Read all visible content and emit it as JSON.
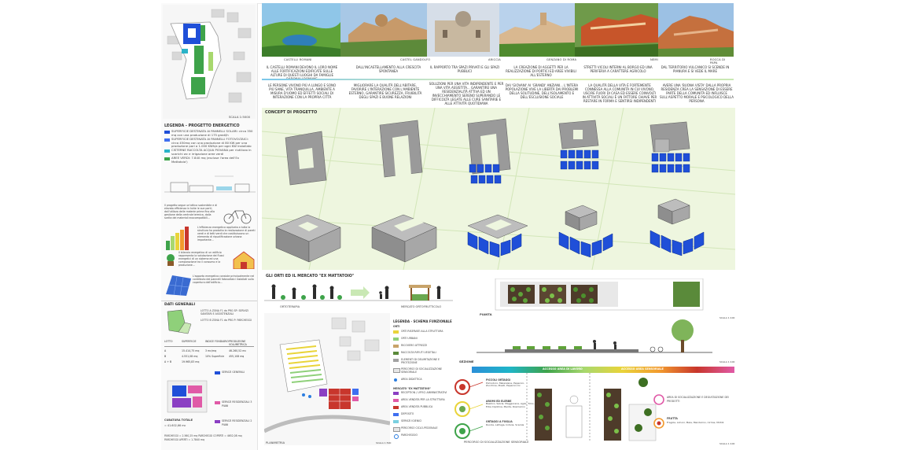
{
  "colors": {
    "blue": "#1f4fd8",
    "blue_light": "#3f6ff0",
    "gray_block": "#8c8c8c",
    "green": "#3ea34a",
    "green_light": "#a8d86e",
    "concept_bg": "#eef6df",
    "pink": "#e05aa7",
    "purple": "#8b3fc3",
    "red": "#c8362c",
    "yellow": "#e9d43a"
  },
  "photos": [
    {
      "caption": "CASTELLI ROMANI",
      "desc": "Il castelli romani devono il loro nome alle fortificazioni edificate sulle alture di questi luoghi da famiglie baronali romane"
    },
    {
      "caption": "CASTEL GANDOLFO",
      "desc": "Dall'incastellamento alla crescita spontanea"
    },
    {
      "caption": "ARICCIA",
      "desc": "Il rapporto tra spazi privati e gli spazi pubblici"
    },
    {
      "caption": "GENZANO DI ROMA",
      "desc": "La creazione di aggetti per la realizzazione di portici ed aree vivibili all'esterno"
    },
    {
      "caption": "NEMI",
      "desc": "Stretti vicoli interni al borgo ed una periferia a carattere agricolo"
    },
    {
      "caption": "ROCCA DI PAPA",
      "desc": "Dal territorio vulcanico si scende in pianura e si vede il mare"
    }
  ],
  "principles": [
    "Le persone vivono più a lungo e sono più sane, vita tranquilla, ambiente a misura d'uomo ed effetti sociali di interazione con la propria città",
    "Migliorare la qualità dell'abitare, favorire l'interazione con l'ambiente esterno, garantire sicurezza, fruibilità degli spazi e buone relazioni",
    "Soluzioni per una vita indipendente e per una vita assistita... garantire una residenzialità attiva ed un invecchiamento sereno superando le difficoltà legate alle cure sanitarie e alle attività quotidiana",
    "Dai 'giovani' ai 'grandi' anziani... l'intera popolazione vive la libertà dai problemi della solitudine, dell'isolamento e dell'esclusione sociale",
    "La qualità della vita è fortemente connessa alla comunità in cui vivono, uscire fuori di casa ed essere coinvolti in attività sociali è un fattore chiave per restare in forma e sentirsi indipendenti",
    "Avere una 'buona vista' dalla propria residenza crea la sensazione di essere parte della comunità ed influisce sull'aspetto morale e psicologico della persona"
  ],
  "concept_title": "CONCEPT DI PROGETTO",
  "left_col": {
    "scale": "SCALA 1:5000",
    "legend_title": "LEGENDA - PROGETTO ENERGETICO",
    "legend": [
      "SUPERFICIE DESTINATA AI PANNELLI SOLARI: circa 350 mq con una produzione di 175 gradi/h",
      "SUPERFICIE DESTINATA AI PANNELLI FOTOVOLTAICI: circa 450mq con una produzione di 80 KW per una produzione pari a 1.000 KWh/a per ogni KW installato",
      "CISTERNE RACCOLTA ACQUA PIOVANA per riutilizzo in scarichi wc e irrigazione aree verdi",
      "AREE VERDI: 7.840 mq (escluse l'area dell'Ex Mattatoio')"
    ],
    "energy_text_1": "Il progetto segue un'ottica sostenibile e di elevata efficienza in tutte le sue parti; dall'utilizzo delle materie prime fino alla gestione della centrale termica, dalla scelta dei materiali ecocompatibili...",
    "energy_text_2": "L'efficienza energetica applicata a tutta la struttura ha prodotto la realizzazione di pareti verdi e di tetti verdi che costituiscono un elemento di riqualificazione urbana importante...",
    "energy_text_3": "Il bilancio energetico di un edificio rappresenta la valutazione dei flussi energetici di un sistema ed una comparazione tra il consumo e la produzione...",
    "energy_text_4": "L'apporto energetico consiste principalmente nel contributo dei pannelli fotovoltaici installati sulla copertura dell'edificio...",
    "dati_title": "DATI GENERALI",
    "lotto_labels": [
      "LOTTO A ZONA F1 da PRG SP: SERVIZI SANITARI E ASSISTENZIALI",
      "LOTTO B ZONA F1 da PRG P: PARCHEGGI"
    ],
    "table_head": [
      "LOTTO",
      "SUPERFICIE",
      "INDICE FONDIARIO",
      "PRODUZIONE VOLUMETRICA"
    ],
    "table_rows": [
      [
        "A",
        "15.414,75 mq",
        "3 mc/mq",
        "46.260,52 mc"
      ],
      [
        "B",
        "4.551,08 mq",
        "10% Superficie",
        "455,108 mq"
      ],
      [
        "A + B",
        "19.965,83 mq",
        "",
        ""
      ]
    ],
    "servizi_labels": [
      "SERVIZI GENERALI",
      "SERVIZI RESIDENZIALI 3 PIANI",
      "SERVIZI RESIDENZIALI 2 PIANI"
    ],
    "cubatura_label": "CUBATURA TOTALE",
    "cubatura_value": "= 41.602,66 mc",
    "parcheggi": "PARCHEGGI = 2.560,25 mq   PARCHEGGI COPERTI = 4652,08 mq   PARCHEGGI APERTI = 1.7840 mq"
  },
  "orti": {
    "title": "GLI ORTI ED IL MERCATO \"EX MATTATOIO\"",
    "label_left": "ORTOTERAPIA",
    "label_right": "MERCATO ORTOFRUTTICOLO"
  },
  "plan": {
    "label": "PLANIMETRIA",
    "scale": "SCALA 1:500",
    "legend_title": "LEGENDA - SCHEMA FUNZIONALE",
    "legend_orti": "ORTI",
    "legend_items": [
      "ORTI RISERVATI ALLA STRUTTURA",
      "ORTI URBANI",
      "RICOVERO ATTREZZI",
      "RACCOLTA RIFIUTI VEGETALI",
      "ELEMENTI DI DELIMITAZIONE E PROTEZIONE",
      "PERCORSO DI SOCIALIZZAZIONE SENSORIALE",
      "AREA DIDATTICA"
    ],
    "legend_mercato": "MERCATO \"EX MATTATOIO\"",
    "legend_items_2": [
      "RECEPTION / UFFICI AMMINISTRATIVI",
      "AREA VENDITA PER LA STRUTTURA",
      "AREA VENDITA PUBBLICA",
      "DEPOSITO",
      "SERVIZI IGIENICI",
      "PERCORSO CICLO-PEDONALE",
      "PARCHEGGIO"
    ]
  },
  "right": {
    "pianta": "PIANTA",
    "sezione": "SEZIONE",
    "scale": "SCALA 1:100",
    "access_1": "ACCESSO AREA DI LAVORO",
    "access_2": "ACCESSO AREA SENSORIALE",
    "percorso": "PERCORSO DI SOCIALIZZAZIONE SENSORIALE",
    "callouts": [
      {
        "title": "PICCOLI ORTAGGI",
        "text": "Pomodoro, Melanzane, Peperoni, Zucchine, Piselli, Peperoncini"
      },
      {
        "title": "AROMI ED ELERBE",
        "text": "Basilico, Salvia, Maggiorana, Aglio, Timo, Erba Cipollina, Menta, Rosmarino"
      },
      {
        "title": "ORTAGGI A FOGLIA",
        "text": "Rucola, Lattuga, Indivia, Scarola"
      }
    ],
    "callouts_right": [
      {
        "title": "AREA DI SOCIALIZZAZIONE E DEGUSTAZIONE DEI PRODOTTI",
        "text": ""
      },
      {
        "title": "FRUTTA",
        "text": "Fragole, Limoni, Mele, Mandarino, Cirmie, Mirtilli"
      }
    ]
  }
}
